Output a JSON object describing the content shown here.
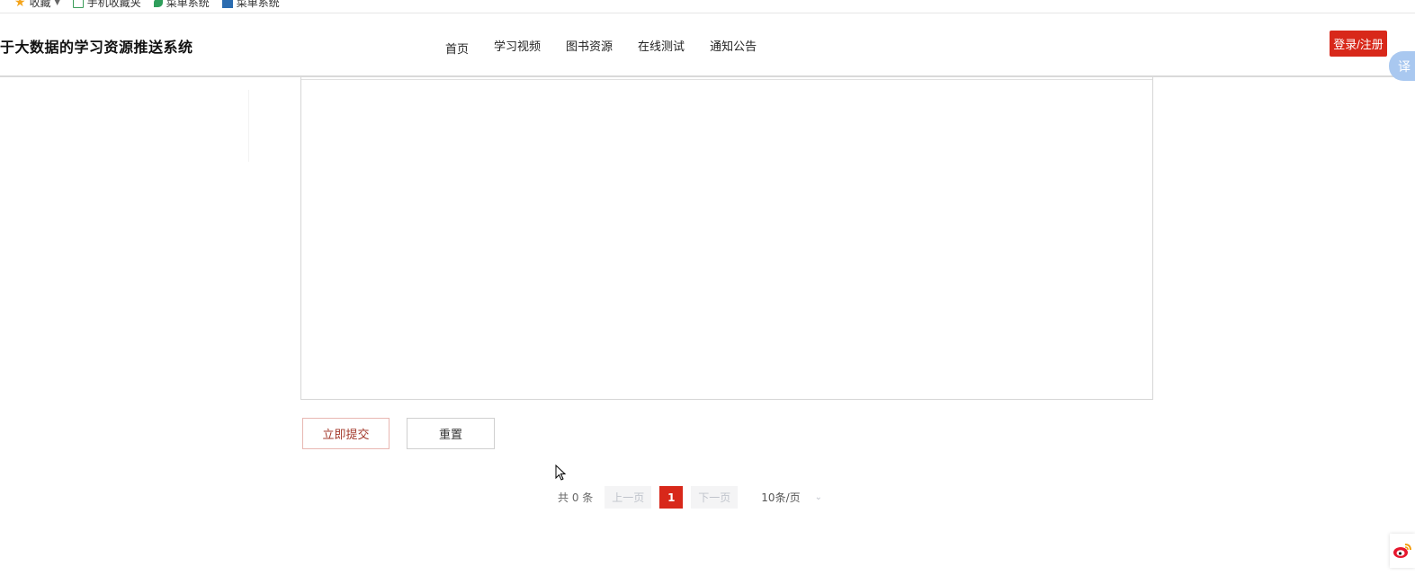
{
  "bookmarks": [
    {
      "label": "收藏",
      "icon": "star-icon"
    },
    {
      "label": "手机收藏夹",
      "icon": "folder-icon"
    },
    {
      "label": "菜单系统",
      "icon": "leaf-icon"
    },
    {
      "label": "菜单系统",
      "icon": "square-icon"
    }
  ],
  "header": {
    "site_title": "于大数据的学习资源推送系统",
    "nav": [
      {
        "label": "首页"
      },
      {
        "label": "学习视频"
      },
      {
        "label": "图书资源"
      },
      {
        "label": "在线测试"
      },
      {
        "label": "通知公告"
      }
    ],
    "login_label": "登录/注册"
  },
  "translate_widget": {
    "label": "译"
  },
  "form": {
    "submit_label": "立即提交",
    "reset_label": "重置"
  },
  "pagination": {
    "total_text": "共 0 条",
    "prev_label": "上一页",
    "current_page": "1",
    "next_label": "下一页",
    "page_size_label": "10条/页"
  },
  "colors": {
    "accent": "#d8281a",
    "translate_widget": "#a9c8f0"
  }
}
